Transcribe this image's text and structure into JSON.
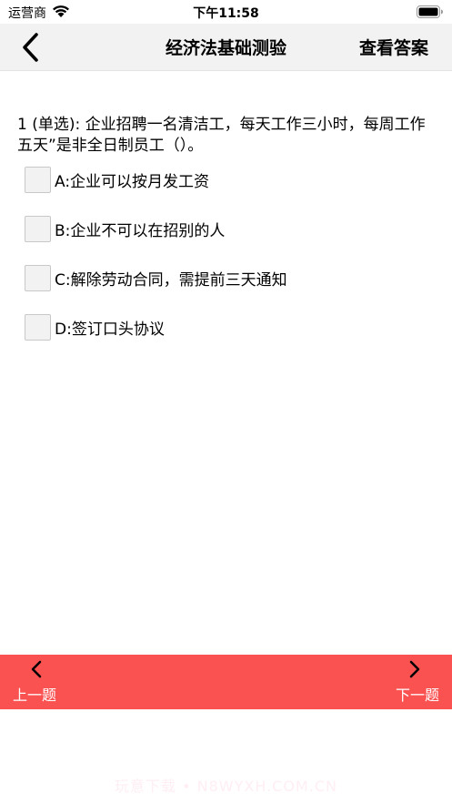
{
  "status_bar": {
    "carrier": "运营商",
    "time": "下午11:58"
  },
  "nav": {
    "title": "经济法基础测验",
    "answer_button": "查看答案",
    "back_icon": "chevron-left-icon"
  },
  "question": {
    "text": "1 (单选): 企业招聘一名清洁工，每天工作三小时，每周工作五天”是非全日制员工（）。"
  },
  "options": [
    {
      "label": "A:企业可以按月发工资",
      "checked": false
    },
    {
      "label": "B:企业不可以在招别的人",
      "checked": false
    },
    {
      "label": "C:解除劳动合同，需提前三天通知",
      "checked": false
    },
    {
      "label": "D:签订口头协议",
      "checked": false
    }
  ],
  "footer": {
    "prev_label": "上一题",
    "next_label": "下一题",
    "background_color": "#fa5151"
  },
  "watermark": {
    "text": "玩意下载 • N8WYXH.COM.CN"
  }
}
